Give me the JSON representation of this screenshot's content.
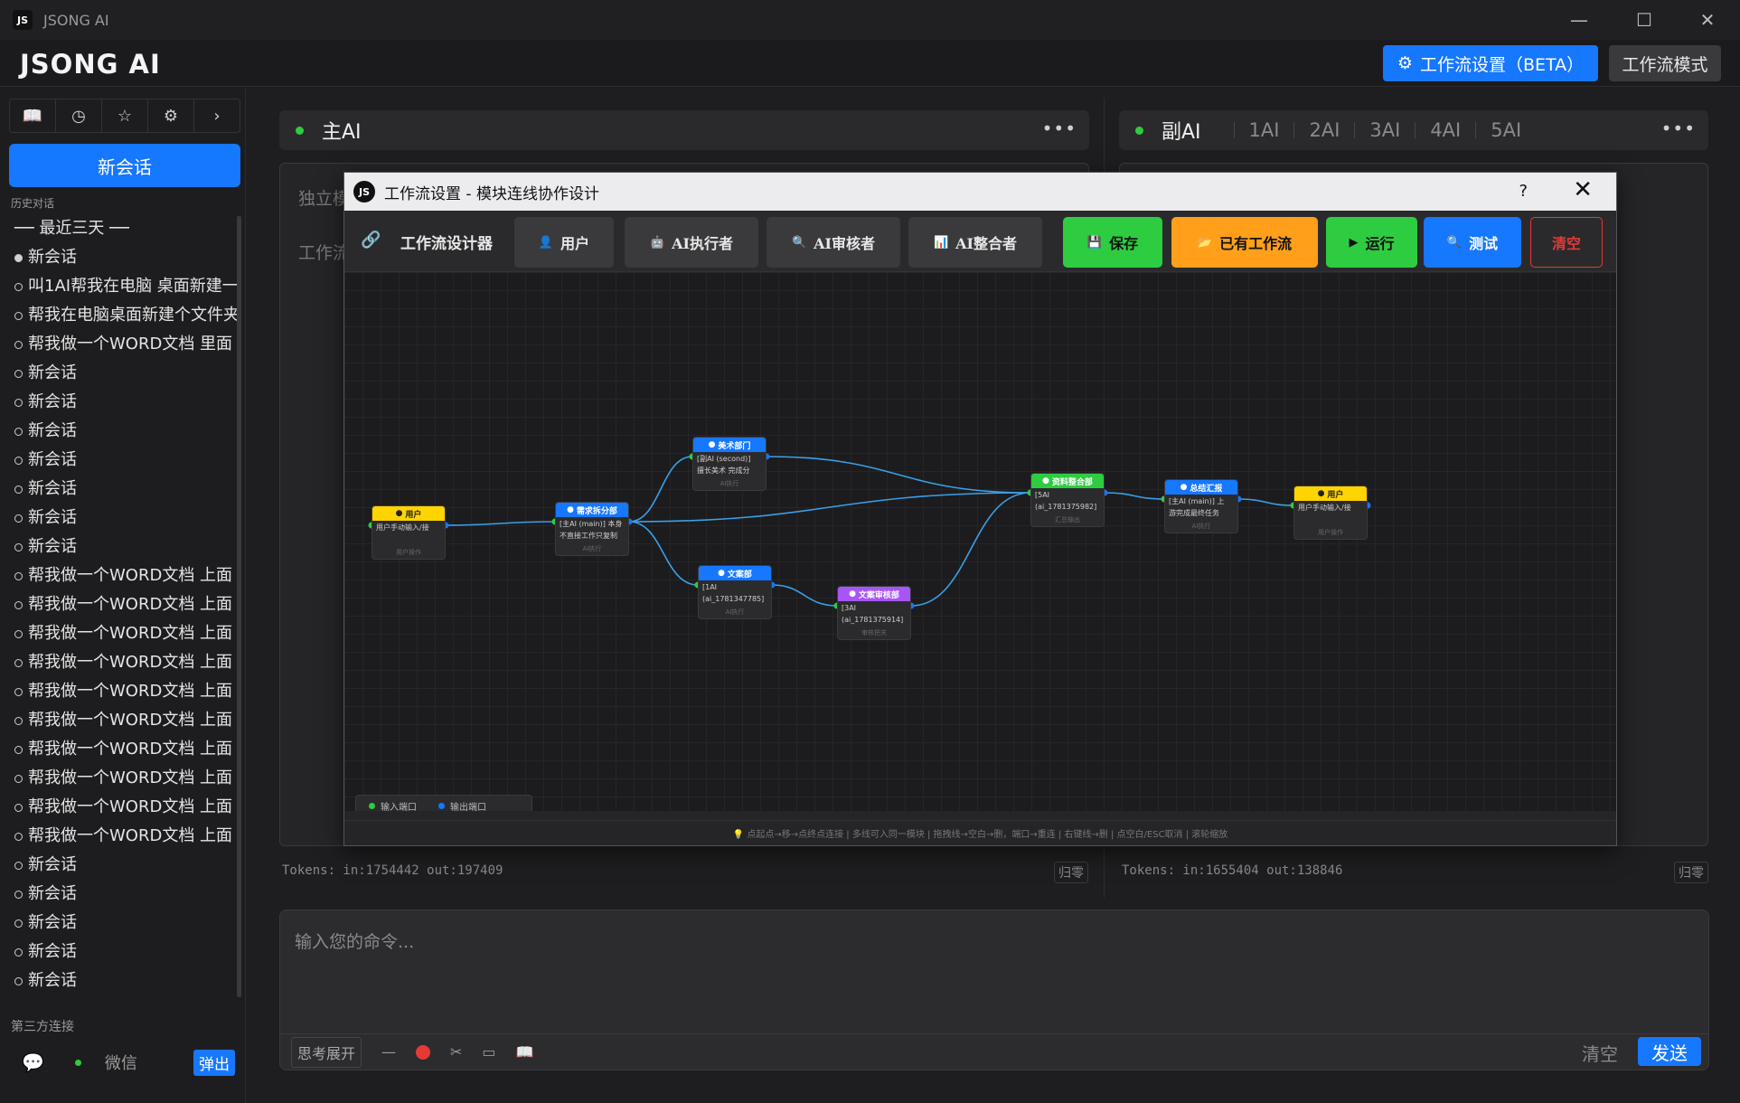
{
  "window": {
    "title": "JSONG AI",
    "logo": "JS"
  },
  "header": {
    "brand": "JSONG AI",
    "workflow_settings": "工作流设置（BETA）",
    "workflow_mode": "工作流模式",
    "accent": "#1677ff"
  },
  "sidebar": {
    "new_chat": "新会话",
    "history_label": "历史对话",
    "group": "── 最近三天 ──",
    "items": [
      "新会话",
      "叫1AI帮我在电脑 桌面新建一",
      "帮我在电脑桌面新建个文件夹",
      "帮我做一个WORD文档 里面",
      "新会话",
      "新会话",
      "新会话",
      "新会话",
      "新会话",
      "新会话",
      "新会话",
      "帮我做一个WORD文档 上面",
      "帮我做一个WORD文档 上面",
      "帮我做一个WORD文档 上面",
      "帮我做一个WORD文档 上面",
      "帮我做一个WORD文档 上面",
      "帮我做一个WORD文档 上面",
      "帮我做一个WORD文档 上面",
      "帮我做一个WORD文档 上面",
      "帮我做一个WORD文档 上面",
      "帮我做一个WORD文档 上面",
      "新会话",
      "新会话",
      "新会话",
      "新会话",
      "新会话"
    ],
    "third_party_label": "第三方连接",
    "wechat_label": "微信",
    "popout": "弹出"
  },
  "main_ai": {
    "name": "主AI",
    "peek1": "独立模",
    "peek2": "工作流",
    "tokens": "Tokens: in:1754442  out:197409",
    "reset": "归零"
  },
  "sub_ai": {
    "name": "副AI",
    "tabs": [
      "1AI",
      "2AI",
      "3AI",
      "4AI",
      "5AI"
    ],
    "tokens": "Tokens: in:1655404  out:138846",
    "reset": "归零"
  },
  "input": {
    "placeholder": "输入您的命令...",
    "think": "思考展开",
    "clear": "清空",
    "send": "发送"
  },
  "modal": {
    "title": "工作流设置 - 模块连线协作设计",
    "help": "?",
    "designer": "工作流设计器",
    "buttons": {
      "user": "用户",
      "executor": "AI执行者",
      "reviewer": "AI审核者",
      "integrator": "AI整合者",
      "save": "保存",
      "existing": "已有工作流",
      "run": "运行",
      "test": "测试",
      "clear": "清空"
    },
    "colors": {
      "save": "#2ecc40",
      "existing": "#ff9f1a",
      "run": "#2ecc40",
      "test": "#1677ff",
      "clear": "#e53935"
    },
    "legend": {
      "input_port": "输入端口",
      "output_port": "输出端口"
    },
    "footer": "💡 点起点→移→点终点连接  |  多线可入同一模块  |  拖拽线→空白→删，端口→重连  |  右键线→删  |  点空白/ESC取消  |  滚轮缩放"
  },
  "nodes": [
    {
      "id": "n1",
      "title": "用户",
      "body1": "用户手动输入/接",
      "body2": "",
      "footer": "用户操作",
      "color": "#ffd400",
      "text_color": "#222"
    },
    {
      "id": "n2",
      "title": "需求拆分部",
      "body1": "[主AI (main)] 本身",
      "body2": "不直接工作只复制",
      "footer": "AI执行",
      "color": "#1677ff",
      "text_color": "#fff"
    },
    {
      "id": "n3",
      "title": "美术部门",
      "body1": "[副AI (second)]",
      "body2": "擅长美术 完成分",
      "footer": "AI执行",
      "color": "#1677ff",
      "text_color": "#fff"
    },
    {
      "id": "n4",
      "title": "文案部",
      "body1": "[1AI",
      "body2": "(ai_1781347785]",
      "footer": "AI执行",
      "color": "#1677ff",
      "text_color": "#fff"
    },
    {
      "id": "n5",
      "title": "文案审核部",
      "body1": "[3AI",
      "body2": "(ai_1781375914]",
      "footer": "审核把关",
      "color": "#a855f7",
      "text_color": "#fff"
    },
    {
      "id": "n6",
      "title": "资料整合部",
      "body1": "[5AI",
      "body2": "(ai_1781375982]",
      "footer": "汇总输出",
      "color": "#2ecc40",
      "text_color": "#fff"
    },
    {
      "id": "n7",
      "title": "总结汇报",
      "body1": "[主AI (main)] 上",
      "body2": "游完成最终任务",
      "footer": "AI执行",
      "color": "#1677ff",
      "text_color": "#fff"
    },
    {
      "id": "n8",
      "title": "用户",
      "body1": "用户手动输入/接",
      "body2": "",
      "footer": "用户操作",
      "color": "#ffd400",
      "text_color": "#222"
    }
  ]
}
